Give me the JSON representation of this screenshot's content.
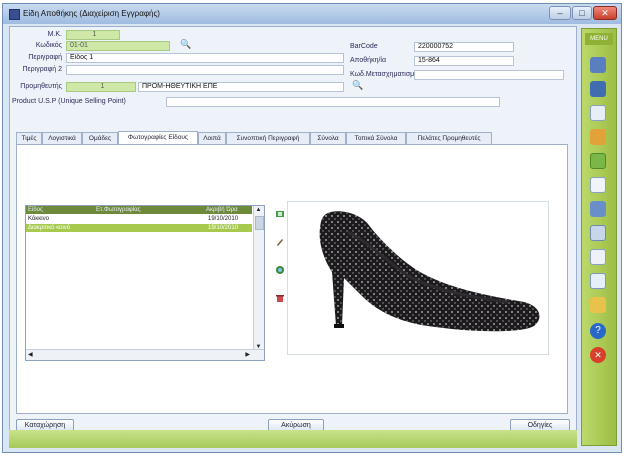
{
  "window": {
    "title": "Είδη Αποθήκης (Διαχείριση Εγγραφής)"
  },
  "form": {
    "mk_label": "Μ.Κ.",
    "mk_value": "1",
    "code_label": "Κωδικός",
    "code_value": "01-01",
    "desc_label": "Περιγραφή",
    "desc_value": "Είδος 1",
    "desc2_label": "Περιγραφή 2",
    "desc2_value": "",
    "supplier_label": "Προμηθευτής",
    "supplier_code": "1",
    "supplier_name": "ΠΡΟΜ-ΗΘΕΥΤΙΚΗ ΕΠΕ",
    "usp_label": "Product U.S.P (Unique Selling Point)",
    "usp_value": "",
    "barcode_label": "BarCode",
    "barcode_value": "220000752",
    "warehouse_label": "Αποθήκη/ία",
    "warehouse_value": "15-864",
    "conversion_label": "Κωδ.Μετασχηματισμού",
    "conversion_value": ""
  },
  "tabs": [
    "Τιμές",
    "Λογιστικά",
    "Ομάδες",
    "Φωτογραφίες Είδους",
    "Λοιπά",
    "Συνοπτική Περιγραφή",
    "Σύνολα",
    "Τοπικά Σύνολα",
    "Πελάτες Προμηθευτές"
  ],
  "photos": {
    "columns": [
      "Είδος",
      "Ετ.Φωτογραφίας",
      "Ακριβή Ώρα"
    ],
    "rows": [
      {
        "name": "Κόκκινο",
        "type": "",
        "date": "19/10/2010"
      },
      {
        "name": "Διακριτικό κοινό",
        "type": "",
        "date": "19/10/2010"
      }
    ]
  },
  "buttons": {
    "save": "Καταχώρηση",
    "cancel": "Ακύρωση",
    "guide": "Οδηγίες"
  },
  "sidebar": {
    "top_label": "MENU"
  },
  "colors": {
    "accent_green": "#a6c94e",
    "title_blue": "#9fbbe0",
    "close_red": "#c8402c"
  }
}
